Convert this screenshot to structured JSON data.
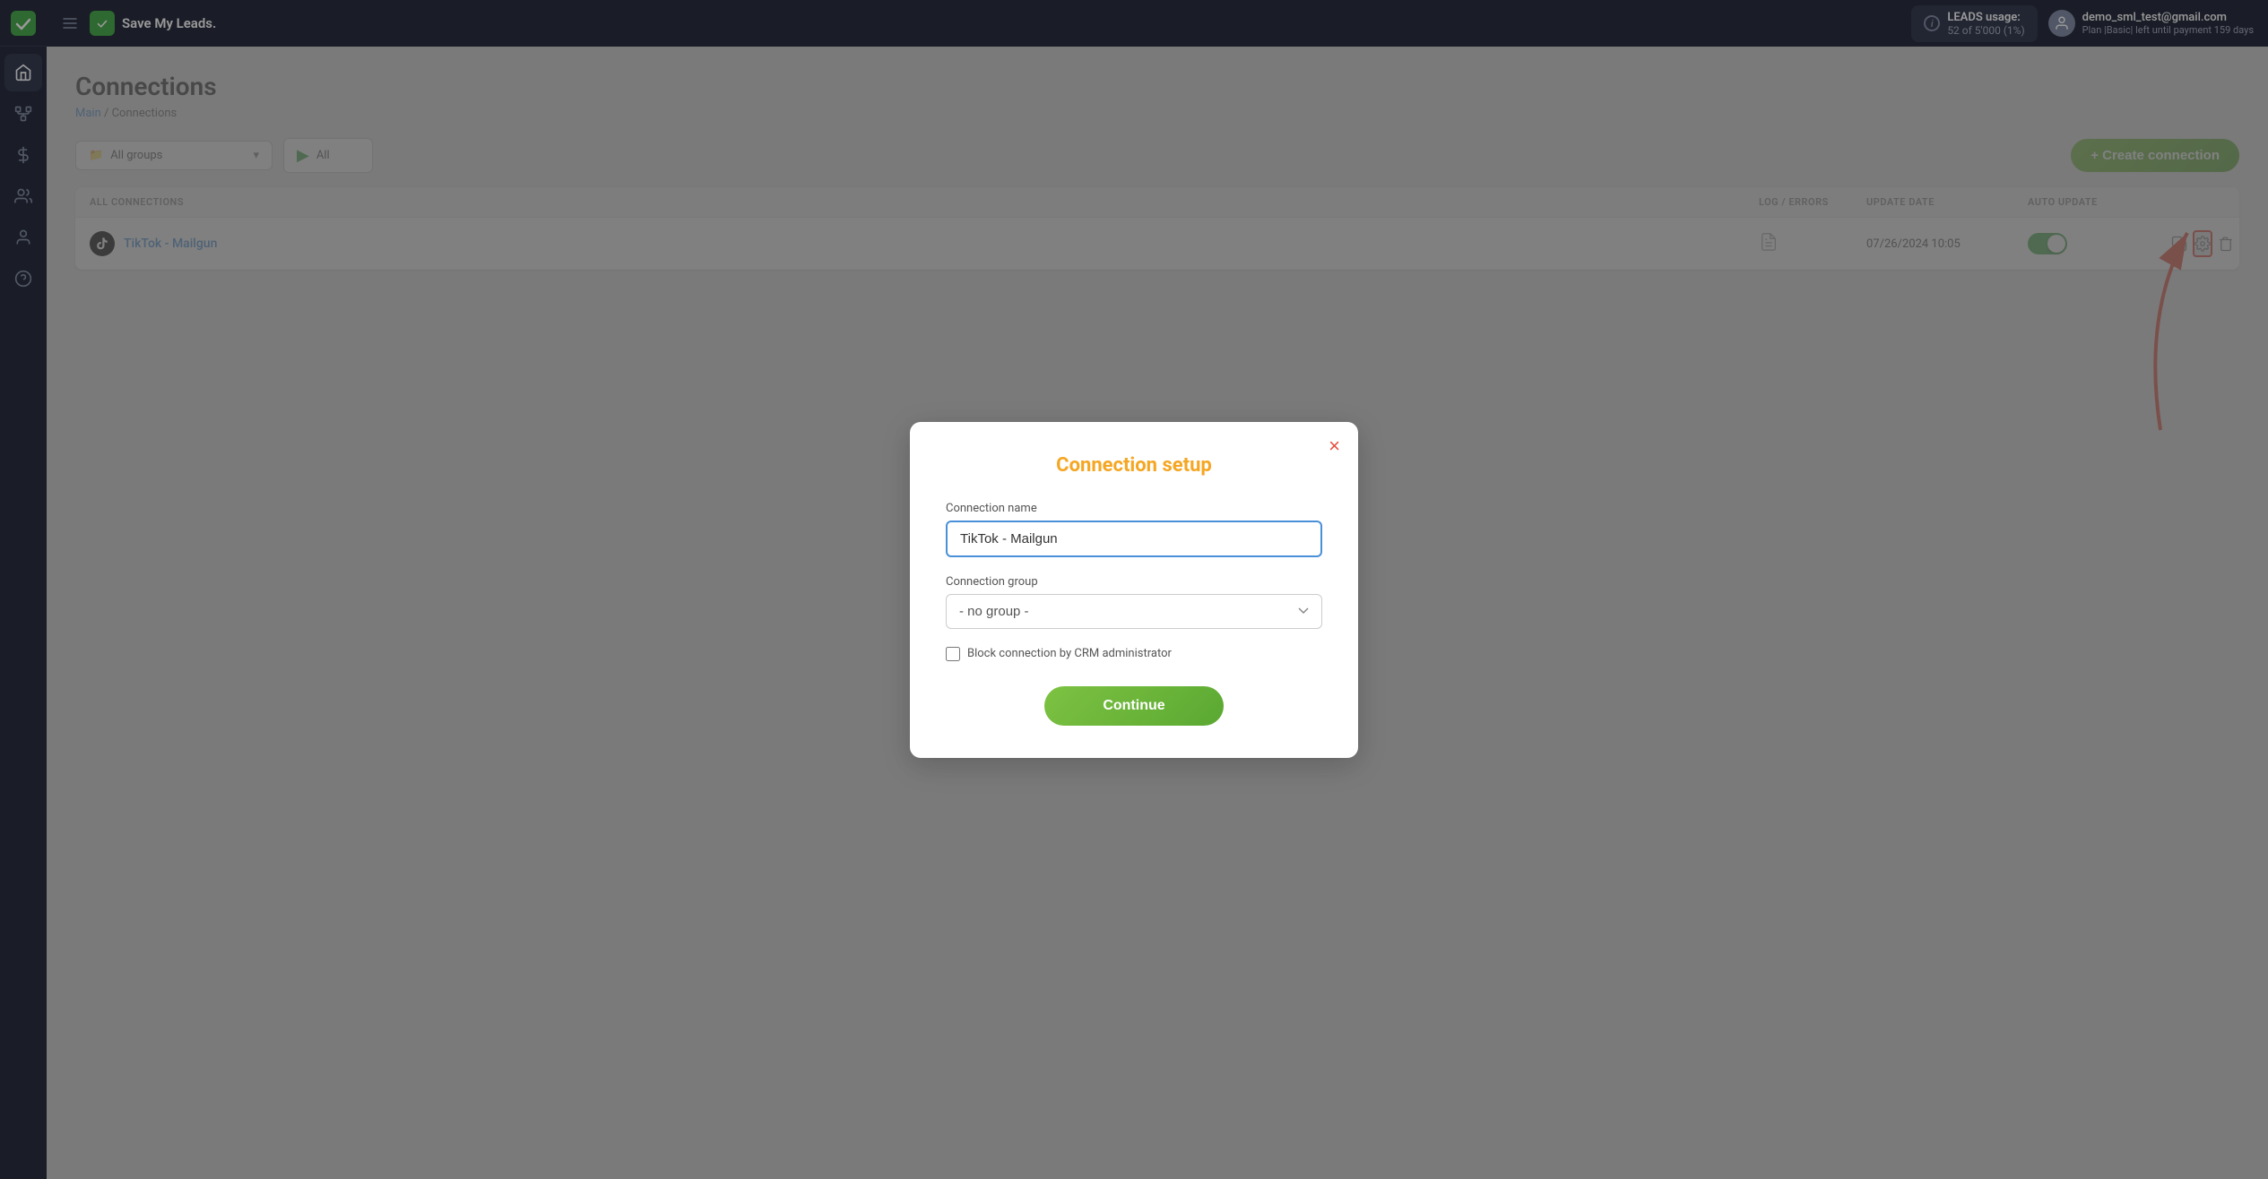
{
  "app": {
    "name": "Save My Leads.",
    "logo_alt": "SML"
  },
  "topbar": {
    "hamburger_label": "menu",
    "leads_label": "LEADS usage:",
    "leads_count": "52 of 5'000 (1%)",
    "user_email": "demo_sml_test@gmail.com",
    "user_plan": "Plan |Basic| left until payment 159 days"
  },
  "sidebar": {
    "items": [
      {
        "name": "home",
        "icon": "home"
      },
      {
        "name": "connections",
        "icon": "connections",
        "active": true
      },
      {
        "name": "billing",
        "icon": "dollar"
      },
      {
        "name": "team",
        "icon": "team"
      },
      {
        "name": "profile",
        "icon": "profile"
      },
      {
        "name": "help",
        "icon": "help"
      }
    ]
  },
  "page": {
    "title": "Connections",
    "breadcrumb_main": "Main",
    "breadcrumb_sep": " / ",
    "breadcrumb_current": "Connections"
  },
  "filters": {
    "group_label": "All groups",
    "status_label": "All",
    "create_button": "+ Create connection"
  },
  "table": {
    "header": {
      "col_all": "ALL CONNECTIONS",
      "col_log": "LOG / ERRORS",
      "col_update": "UPDATE DATE",
      "col_auto": "AUTO UPDATE"
    },
    "rows": [
      {
        "name": "TikTok - Mailgun",
        "log_icon": "document",
        "update_date": "07/26/2024",
        "update_time": "10:05",
        "auto_update": true
      }
    ]
  },
  "modal": {
    "title": "Connection setup",
    "close_label": "×",
    "name_label": "Connection name",
    "name_value": "TikTok - Mailgun",
    "group_label": "Connection group",
    "group_placeholder": "- no group -",
    "group_options": [
      "- no group -"
    ],
    "block_label": "Block connection by CRM administrator",
    "continue_button": "Continue"
  }
}
